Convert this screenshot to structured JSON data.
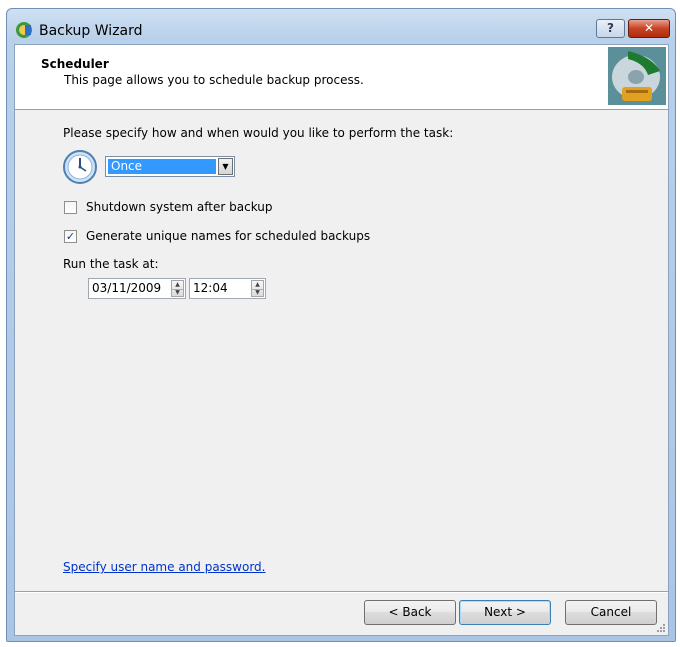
{
  "window": {
    "title": "Backup Wizard",
    "help_label": "?",
    "close_label": "✕"
  },
  "header": {
    "title": "Scheduler",
    "subtitle": "This page allows you to schedule backup process."
  },
  "content": {
    "intro": "Please specify how and when would you like to perform the task:",
    "frequency": {
      "selected": "Once",
      "arrow": "▼"
    },
    "shutdown_checkbox": {
      "label": "Shutdown system after backup",
      "checked": false
    },
    "unique_names_checkbox": {
      "label": "Generate unique names for scheduled backups",
      "checked": true,
      "mark": "✓"
    },
    "run_at_label": "Run the task at:",
    "date_value": "03/11/2009",
    "time_value": "12:04",
    "spin_up": "▲",
    "spin_down": "▼",
    "user_link": "Specify user name and password."
  },
  "footer": {
    "back_label": "< Back",
    "next_label": "Next >",
    "cancel_label": "Cancel"
  },
  "colors": {
    "selection": "#3399ff",
    "link": "#0033cc",
    "close_button": "#c74325"
  }
}
